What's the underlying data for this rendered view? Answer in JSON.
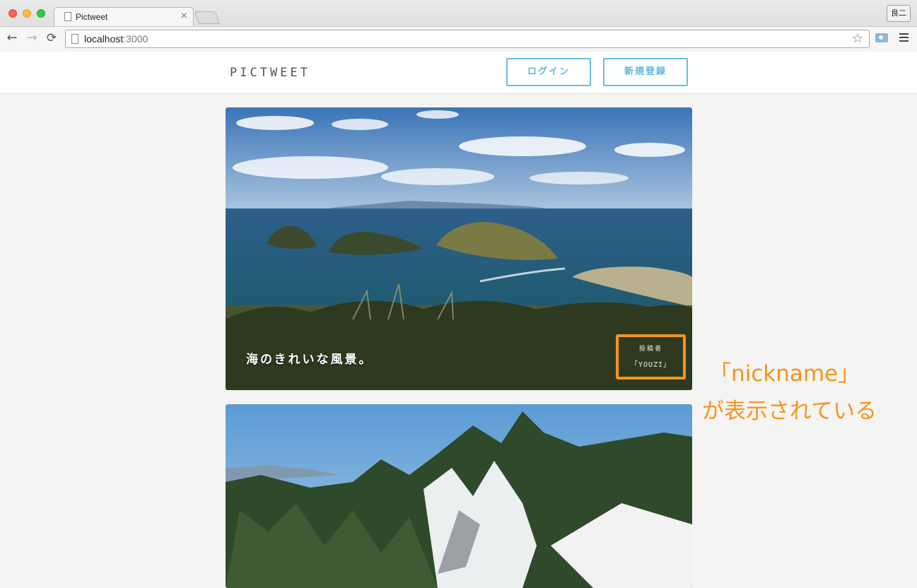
{
  "browser": {
    "tab_title": "Pictweet",
    "tab_close": "×",
    "profile_name": "良二",
    "url_host": "localhost",
    "url_port": ":3000",
    "back_icon": "←",
    "forward_icon": "→",
    "reload_icon": "⟳",
    "star_icon": "☆"
  },
  "header": {
    "logo": "PICTWEET",
    "login_label": "ログイン",
    "signup_label": "新規登録"
  },
  "tweets": [
    {
      "text": "海のきれいな風景。",
      "poster_label": "投稿者",
      "poster_name": "「YOUZI」"
    }
  ],
  "annotation": {
    "line1": "「nickname」",
    "line2": "が表示されている",
    "color": "#f7941d"
  },
  "colors": {
    "button_border": "#68bde6",
    "highlight_box": "#f7941d"
  }
}
